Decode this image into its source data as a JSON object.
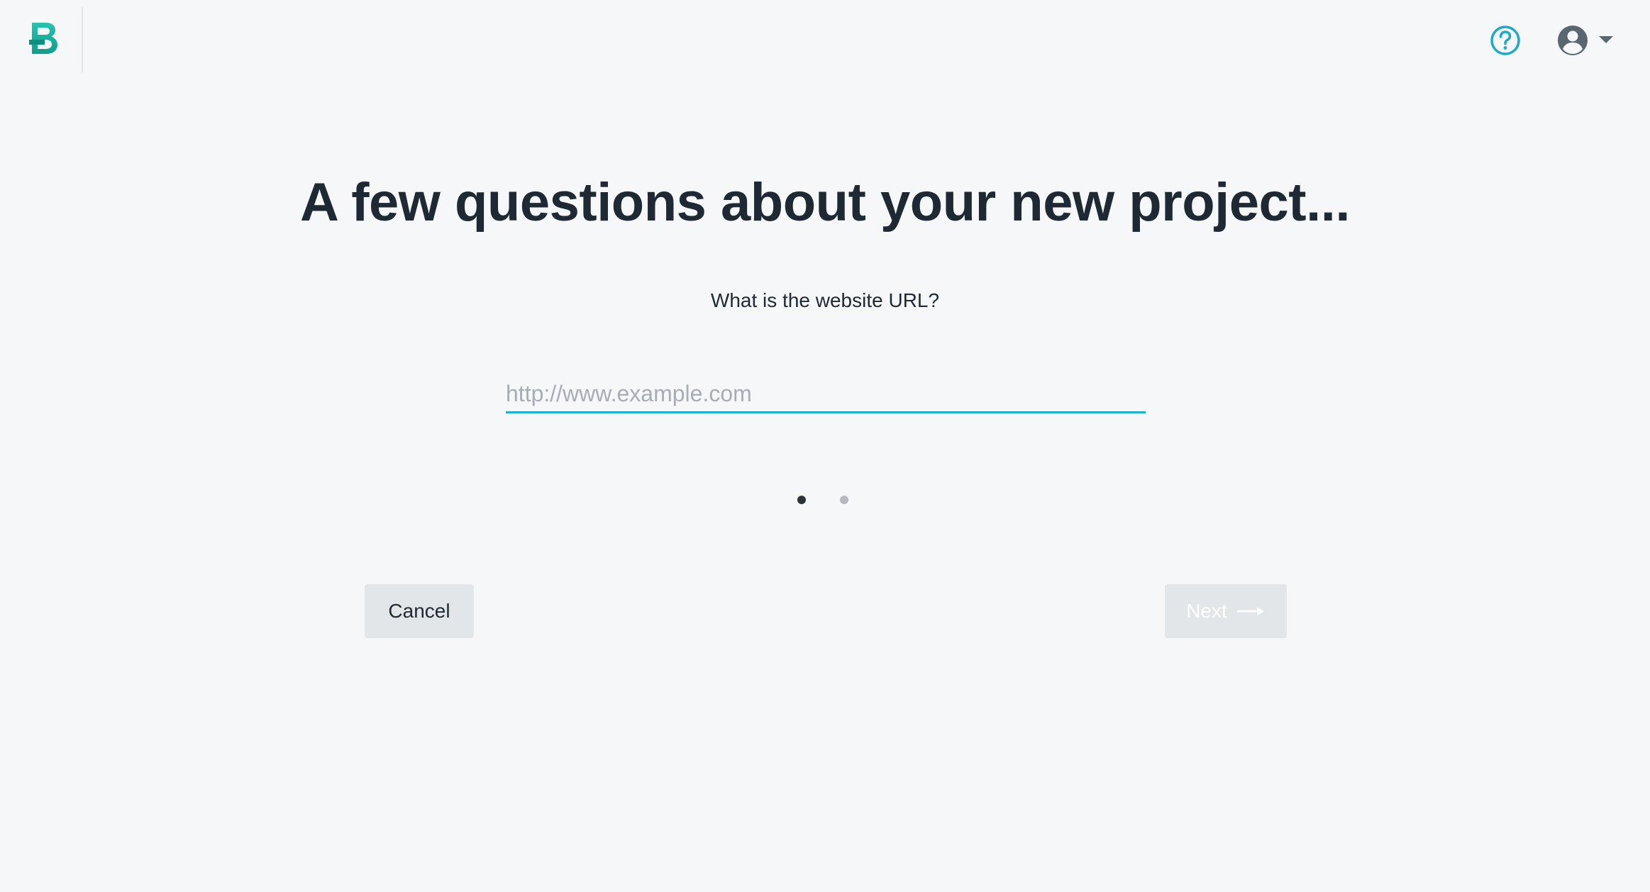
{
  "app": {
    "logo_letter": "B",
    "brand_color": "#1eb8a6",
    "accent_color": "#1fb1d1"
  },
  "header": {
    "help_icon": "help-circle-icon",
    "account_icon": "user-circle-icon",
    "account_caret_icon": "caret-down-icon"
  },
  "main": {
    "title": "A few questions about your new project...",
    "question": "What is the website URL?",
    "url_input": {
      "value": "",
      "placeholder": "http://www.example.com"
    },
    "pager": {
      "total_steps": 2,
      "current_step": 1
    },
    "cancel_label": "Cancel",
    "next_label": "Next",
    "next_icon": "arrow-right-icon",
    "next_disabled": true
  }
}
